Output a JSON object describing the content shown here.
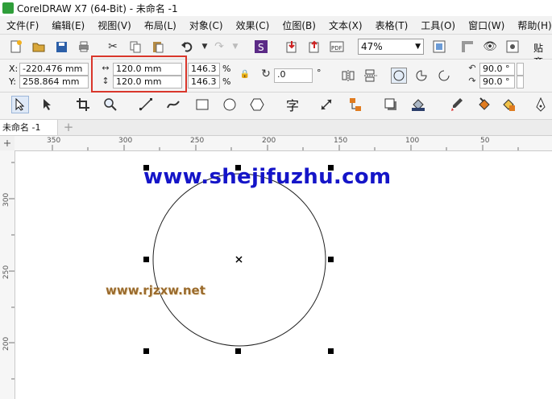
{
  "window": {
    "title": "CorelDRAW X7 (64-Bit) - 未命名 -1"
  },
  "menu": [
    "文件(F)",
    "编辑(E)",
    "视图(V)",
    "布局(L)",
    "对象(C)",
    "效果(C)",
    "位图(B)",
    "文本(X)",
    "表格(T)",
    "工具(O)",
    "窗口(W)",
    "帮助(H)"
  ],
  "toolbar": {
    "zoom": "47%",
    "paste_label": "贴齐"
  },
  "property_bar": {
    "x_label": "X:",
    "x_value": "-220.476 mm",
    "y_label": "Y:",
    "y_value": "258.864 mm",
    "width_value": "120.0 mm",
    "height_value": "120.0 mm",
    "scale_w": "146.3",
    "scale_h": "146.3",
    "percent": "%",
    "rotation": ".0",
    "degree": "°",
    "angle_start": "90.0 °",
    "angle_end": "90.0 °"
  },
  "toolbox": {
    "text_tool_glyph": "字"
  },
  "tabs": [
    {
      "label": "未命名 -1"
    }
  ],
  "rulers": {
    "h_ticks": [
      "350",
      "300",
      "250",
      "200",
      "150",
      "100",
      "50"
    ],
    "v_ticks": [
      "300",
      "250",
      "200"
    ]
  },
  "canvas": {
    "watermark_top": "www.shejifuzhu.com",
    "watermark_bottom": "www.rjzxw.net"
  }
}
